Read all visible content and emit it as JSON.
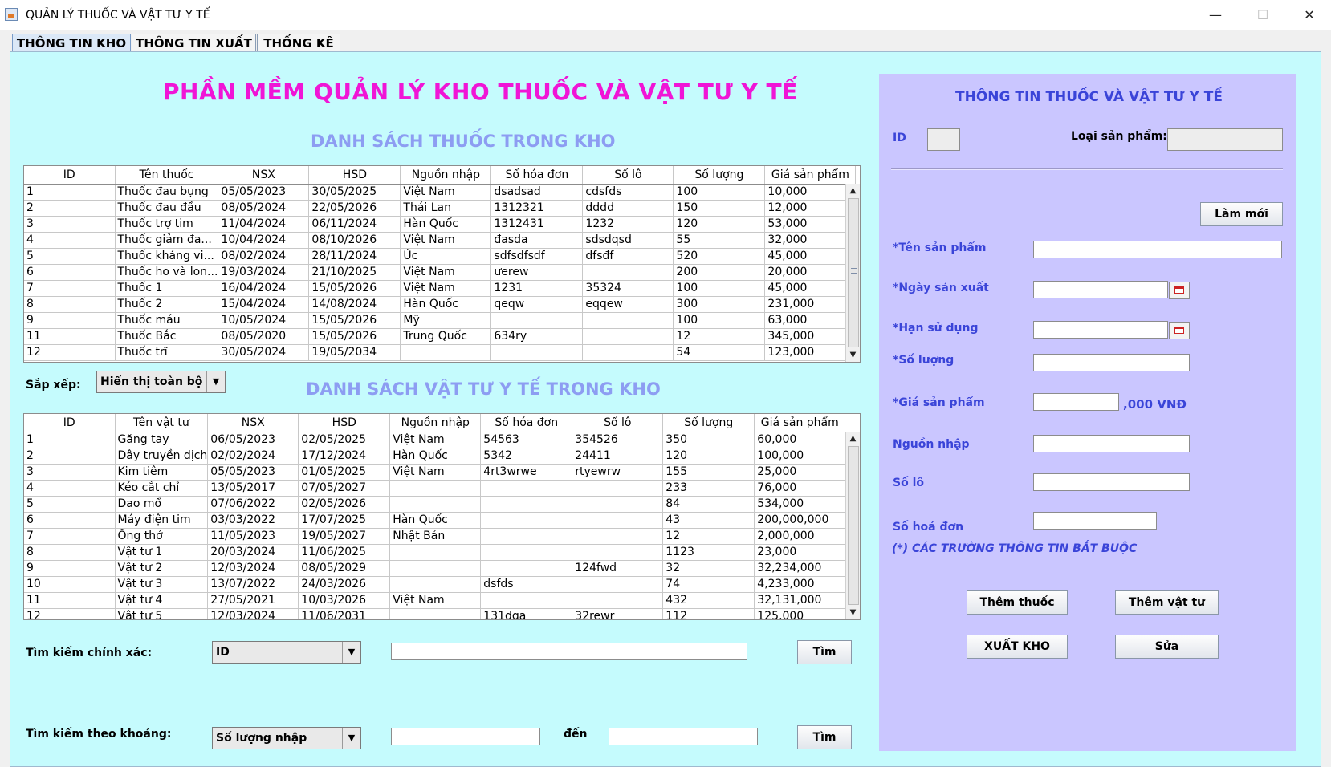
{
  "window": {
    "title": "QUẢN LÝ THUỐC VÀ VẬT TƯ Y TẾ",
    "minimize": "—",
    "maximize": "☐",
    "close": "✕"
  },
  "tabs": [
    {
      "label": "THÔNG TIN KHO",
      "active": true
    },
    {
      "label": "THÔNG TIN XUẤT",
      "active": false
    },
    {
      "label": "THỐNG KÊ",
      "active": false
    }
  ],
  "main_title": "PHẦN MỀM QUẢN LÝ KHO THUỐC VÀ VẬT TƯ Y TẾ",
  "medicine_section_title": "DANH SÁCH THUỐC TRONG KHO",
  "supply_section_title": "DANH SÁCH VẬT TƯ Y TẾ TRONG KHO",
  "medicine_table": {
    "columns": [
      "ID",
      "Tên thuốc",
      "NSX",
      "HSD",
      "Nguồn nhập",
      "Số hóa đơn",
      "Số lô",
      "Số lượng",
      "Giá sản phẩm"
    ],
    "rows": [
      [
        "1",
        "Thuốc đau bụng",
        "05/05/2023",
        "30/05/2025",
        "Việt Nam",
        "dsadsad",
        "cdsfds",
        "100",
        "10,000"
      ],
      [
        "2",
        "Thuốc đau đầu",
        "08/05/2024",
        "22/05/2026",
        "Thái Lan",
        "1312321",
        "dddd",
        "150",
        "12,000"
      ],
      [
        "3",
        "Thuốc trợ tim",
        "11/04/2024",
        "06/11/2024",
        "Hàn Quốc",
        "1312431",
        "1232",
        "120",
        "53,000"
      ],
      [
        "4",
        "Thuốc giảm đa...",
        "10/04/2024",
        "08/10/2026",
        "Việt Nam",
        "đasda",
        "sdsdqsd",
        "55",
        "32,000"
      ],
      [
        "5",
        "Thuốc kháng vi...",
        "08/02/2024",
        "28/11/2024",
        "Úc",
        "sdfsdfsdf",
        "dfsđf",
        "520",
        "45,000"
      ],
      [
        "6",
        "Thuốc ho và lon...",
        "19/03/2024",
        "21/10/2025",
        "Việt Nam",
        "ưerew",
        "",
        "200",
        "20,000"
      ],
      [
        "7",
        "Thuốc 1",
        "16/04/2024",
        "15/05/2026",
        "Việt Nam",
        "1231",
        "35324",
        "100",
        "45,000"
      ],
      [
        "8",
        "Thuốc 2",
        "15/04/2024",
        "14/08/2024",
        "Hàn Quốc",
        "qeqw",
        "eqqew",
        "300",
        "231,000"
      ],
      [
        "9",
        "Thuốc máu",
        "10/05/2024",
        "15/05/2026",
        "Mỹ",
        "",
        "",
        "100",
        "63,000"
      ],
      [
        "11",
        "Thuốc Bắc",
        "08/05/2020",
        "15/05/2026",
        "Trung Quốc",
        "634ry",
        "",
        "12",
        "345,000"
      ],
      [
        "12",
        "Thuốc trĩ",
        "30/05/2024",
        "19/05/2034",
        "",
        "",
        "",
        "54",
        "123,000"
      ]
    ]
  },
  "supply_table": {
    "columns": [
      "ID",
      "Tên vật tư",
      "NSX",
      "HSD",
      "Nguồn nhập",
      "Số hóa đơn",
      "Số lô",
      "Số lượng",
      "Giá sản phẩm"
    ],
    "rows": [
      [
        "1",
        "Găng tay",
        "06/05/2023",
        "02/05/2025",
        "Việt Nam",
        "54563",
        "354526",
        "350",
        "60,000"
      ],
      [
        "2",
        "Dây truyền dịch",
        "02/02/2024",
        "17/12/2024",
        "Hàn Quốc",
        "5342",
        "24411",
        "120",
        "100,000"
      ],
      [
        "3",
        "Kim tiêm",
        "05/05/2023",
        "01/05/2025",
        "Việt Nam",
        "4rt3wrwe",
        "rtyewrw",
        "155",
        "25,000"
      ],
      [
        "4",
        "Kéo cắt chỉ",
        "13/05/2017",
        "07/05/2027",
        "",
        "",
        "",
        "233",
        "76,000"
      ],
      [
        "5",
        "Dao mổ",
        "07/06/2022",
        "02/05/2026",
        "",
        "",
        "",
        "84",
        "534,000"
      ],
      [
        "6",
        "Máy điện tim",
        "03/03/2022",
        "17/07/2025",
        "Hàn Quốc",
        "",
        "",
        "43",
        "200,000,000"
      ],
      [
        "7",
        "Ống thở",
        "11/05/2023",
        "19/05/2027",
        "Nhật Bản",
        "",
        "",
        "12",
        "2,000,000"
      ],
      [
        "8",
        "Vật tư 1",
        "20/03/2024",
        "11/06/2025",
        "",
        "",
        "",
        "1123",
        "23,000"
      ],
      [
        "9",
        "Vật tư 2",
        "12/03/2024",
        "08/05/2029",
        "",
        "",
        "124fwd",
        "32",
        "32,234,000"
      ],
      [
        "10",
        "Vật tư 3",
        "13/07/2022",
        "24/03/2026",
        "",
        "dsfds",
        "",
        "74",
        "4,233,000"
      ],
      [
        "11",
        "Vật tư 4",
        "27/05/2021",
        "10/03/2026",
        "Việt Nam",
        "",
        "",
        "432",
        "32,131,000"
      ],
      [
        "12",
        "Vật tư 5",
        "12/03/2024",
        "11/06/2031",
        "",
        "131dqa",
        "32rewr",
        "112",
        "125,000"
      ]
    ]
  },
  "sort": {
    "label": "Sắp xếp:",
    "value": "Hiển thị toàn bộ"
  },
  "exact_search": {
    "label": "Tìm kiếm chính xác:",
    "field": "ID",
    "button": "Tìm"
  },
  "range_search": {
    "label": "Tìm kiếm theo khoảng:",
    "field": "Số lượng nhập",
    "to_label": "đến",
    "button": "Tìm"
  },
  "form": {
    "title": "THÔNG TIN THUỐC VÀ VẬT TƯ Y TẾ",
    "id_label": "ID",
    "type_label": "Loại sản phẩm:",
    "refresh_button": "Làm mới",
    "name_label": "*Tên sản phẩm",
    "mfg_label": "*Ngày sản xuất",
    "exp_label": "*Hạn sử dụng",
    "qty_label": "*Số lượng",
    "price_label": "*Giá sản phẩm",
    "price_suffix": ",000 VNĐ",
    "source_label": "Nguồn nhập",
    "lot_label": "Số lô",
    "invoice_label": "Số hoá đơn",
    "required_note": "(*) CÁC TRƯỜNG THÔNG TIN BẮT BUỘC",
    "add_medicine_button": "Thêm thuốc",
    "add_supply_button": "Thêm vật tư",
    "export_button": "XUẤT KHO",
    "edit_button": "Sửa"
  },
  "colors": {
    "content_bg": "#c5fbfd",
    "panel_bg": "#cac6ff",
    "title_magenta": "#f015d6",
    "section_periwinkle": "#8d9df2",
    "label_blue": "#3a44d8"
  }
}
